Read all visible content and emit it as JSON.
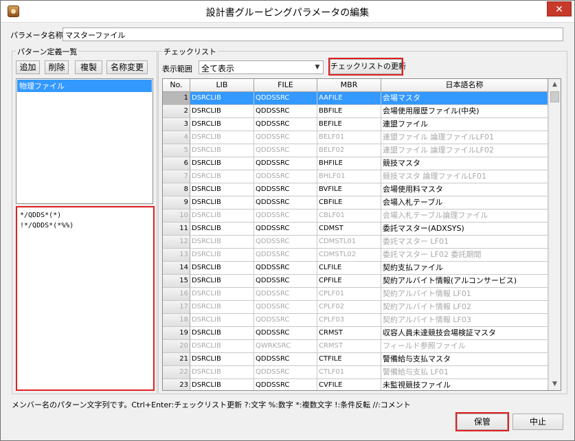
{
  "window": {
    "title": "設計書グルーピングパラメータの編集",
    "close_glyph": "✕"
  },
  "param_name": {
    "label": "パラメータ名称",
    "value": "マスターファイル"
  },
  "pattern_group": {
    "label": "パターン定義一覧",
    "buttons": {
      "add": "追加",
      "delete": "削除",
      "copy": "複製",
      "rename": "名称変更"
    },
    "list_items": [
      "物理ファイル"
    ],
    "pattern_lines": [
      "*/QDDS*(*)",
      "!*/QDDS*(*%%)"
    ]
  },
  "checklist_group": {
    "label": "チェックリスト",
    "range_label": "表示範囲",
    "range_value": "全て表示",
    "update_button": "チェックリストの更新",
    "columns": [
      "No.",
      "LIB",
      "FILE",
      "MBR",
      "日本語名称"
    ],
    "rows": [
      {
        "no": "1",
        "lib": "DSRCLIB",
        "file": "QDDSSRC",
        "mbr": "AAFILE",
        "name": "会場マスタ",
        "state": "sel"
      },
      {
        "no": "2",
        "lib": "DSRCLIB",
        "file": "QDDSSRC",
        "mbr": "BBFILE",
        "name": "会場使用履歴ファイル(中央)",
        "state": "on"
      },
      {
        "no": "3",
        "lib": "DSRCLIB",
        "file": "QDDSSRC",
        "mbr": "BEFILE",
        "name": "連盟ファイル",
        "state": "on"
      },
      {
        "no": "4",
        "lib": "DSRCLIB",
        "file": "QDDSSRC",
        "mbr": "BELF01",
        "name": "連盟ファイル 論理ファイルLF01",
        "state": "dim"
      },
      {
        "no": "5",
        "lib": "DSRCLIB",
        "file": "QDDSSRC",
        "mbr": "BELF02",
        "name": "連盟ファイル 論理ファイルLF02",
        "state": "dim"
      },
      {
        "no": "6",
        "lib": "DSRCLIB",
        "file": "QDDSSRC",
        "mbr": "BHFILE",
        "name": "競技マスタ",
        "state": "on"
      },
      {
        "no": "7",
        "lib": "DSRCLIB",
        "file": "QDDSSRC",
        "mbr": "BHLF01",
        "name": "競技マスタ 論理ファイルLF01",
        "state": "dim"
      },
      {
        "no": "8",
        "lib": "DSRCLIB",
        "file": "QDDSSRC",
        "mbr": "BVFILE",
        "name": "会場使用料マスタ",
        "state": "on"
      },
      {
        "no": "9",
        "lib": "DSRCLIB",
        "file": "QDDSSRC",
        "mbr": "CBFILE",
        "name": "会場入札テーブル",
        "state": "on"
      },
      {
        "no": "10",
        "lib": "DSRCLIB",
        "file": "QDDSSRC",
        "mbr": "CBLF01",
        "name": "会場入札テーブル論理ファイル",
        "state": "dim"
      },
      {
        "no": "11",
        "lib": "DSRCLIB",
        "file": "QDDSSRC",
        "mbr": "CDMST",
        "name": "委託マスター(ADXSYS)",
        "state": "on"
      },
      {
        "no": "12",
        "lib": "DSRCLIB",
        "file": "QDDSSRC",
        "mbr": "CDMSTL01",
        "name": "委託マスター LF01",
        "state": "dim"
      },
      {
        "no": "13",
        "lib": "DSRCLIB",
        "file": "QDDSSRC",
        "mbr": "CDMSTL02",
        "name": "委託マスター LF02 委託期間",
        "state": "dim"
      },
      {
        "no": "14",
        "lib": "DSRCLIB",
        "file": "QDDSSRC",
        "mbr": "CLFILE",
        "name": "契約支払ファイル",
        "state": "on"
      },
      {
        "no": "15",
        "lib": "DSRCLIB",
        "file": "QDDSSRC",
        "mbr": "CPFILE",
        "name": "契約アルバイト情報(アルコンサービス)",
        "state": "on"
      },
      {
        "no": "16",
        "lib": "DSRCLIB",
        "file": "QDDSSRC",
        "mbr": "CPLF01",
        "name": "契約アルバイト情報 LF01",
        "state": "dim"
      },
      {
        "no": "17",
        "lib": "DSRCLIB",
        "file": "QDDSSRC",
        "mbr": "CPLF02",
        "name": "契約アルバイト情報 LF02",
        "state": "dim"
      },
      {
        "no": "18",
        "lib": "DSRCLIB",
        "file": "QDDSSRC",
        "mbr": "CPLF03",
        "name": "契約アルバイト情報 LF03",
        "state": "dim"
      },
      {
        "no": "19",
        "lib": "DSRCLIB",
        "file": "QDDSSRC",
        "mbr": "CRMST",
        "name": "収容人員未達競技会場検証マスタ",
        "state": "on"
      },
      {
        "no": "20",
        "lib": "DSRCLIB",
        "file": "QWRKSRC",
        "mbr": "CRMST",
        "name": "フィールド参照ファイル",
        "state": "dim"
      },
      {
        "no": "21",
        "lib": "DSRCLIB",
        "file": "QDDSSRC",
        "mbr": "CTFILE",
        "name": "警備給与支払マスタ",
        "state": "on"
      },
      {
        "no": "22",
        "lib": "DSRCLIB",
        "file": "QDDSSRC",
        "mbr": "CTLF01",
        "name": "警備給与支払 LF01",
        "state": "dim"
      },
      {
        "no": "23",
        "lib": "DSRCLIB",
        "file": "QDDSSRC",
        "mbr": "CVFILE",
        "name": "未監視競技ファイル",
        "state": "on"
      }
    ]
  },
  "status_help": "メンバー名のパターン文字列です。Ctrl+Enter:チェックリスト更新 ?:文字 %:数字 *:複数文字 !:条件反転 //:コメント",
  "footer": {
    "save": "保管",
    "cancel": "中止"
  },
  "colors": {
    "selection": "#3399ff",
    "highlight_outline": "#e02020"
  }
}
